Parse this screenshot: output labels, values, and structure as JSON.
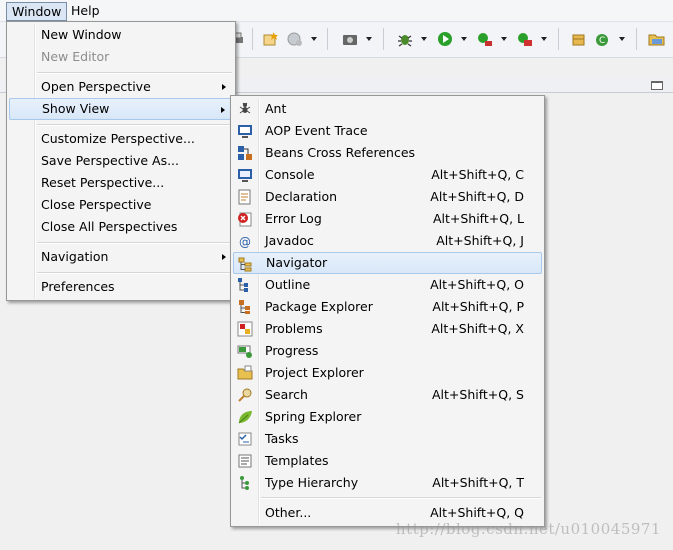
{
  "menubar": {
    "window": "Window",
    "help": "Help"
  },
  "window_menu": {
    "items": [
      {
        "label": "New Window",
        "disabled": false
      },
      {
        "label": "New Editor",
        "disabled": true
      },
      {
        "label": "Open Perspective",
        "submenu": true
      },
      {
        "label": "Show View",
        "submenu": true,
        "highlighted": true
      },
      {
        "label": "Customize Perspective..."
      },
      {
        "label": "Save Perspective As..."
      },
      {
        "label": "Reset Perspective..."
      },
      {
        "label": "Close Perspective"
      },
      {
        "label": "Close All Perspectives"
      },
      {
        "label": "Navigation",
        "submenu": true
      },
      {
        "label": "Preferences"
      }
    ]
  },
  "show_view_menu": {
    "items": [
      {
        "label": "Ant",
        "shortcut": "",
        "icon": "ant-icon"
      },
      {
        "label": "AOP Event Trace",
        "shortcut": "",
        "icon": "aop-event-trace-icon"
      },
      {
        "label": "Beans Cross References",
        "shortcut": "",
        "icon": "beans-cross-references-icon"
      },
      {
        "label": "Console",
        "shortcut": "Alt+Shift+Q, C",
        "icon": "console-icon"
      },
      {
        "label": "Declaration",
        "shortcut": "Alt+Shift+Q, D",
        "icon": "declaration-icon"
      },
      {
        "label": "Error Log",
        "shortcut": "Alt+Shift+Q, L",
        "icon": "error-log-icon"
      },
      {
        "label": "Javadoc",
        "shortcut": "Alt+Shift+Q, J",
        "icon": "javadoc-icon"
      },
      {
        "label": "Navigator",
        "shortcut": "",
        "icon": "navigator-icon",
        "highlighted": true
      },
      {
        "label": "Outline",
        "shortcut": "Alt+Shift+Q, O",
        "icon": "outline-icon"
      },
      {
        "label": "Package Explorer",
        "shortcut": "Alt+Shift+Q, P",
        "icon": "package-explorer-icon"
      },
      {
        "label": "Problems",
        "shortcut": "Alt+Shift+Q, X",
        "icon": "problems-icon"
      },
      {
        "label": "Progress",
        "shortcut": "",
        "icon": "progress-icon"
      },
      {
        "label": "Project Explorer",
        "shortcut": "",
        "icon": "project-explorer-icon"
      },
      {
        "label": "Search",
        "shortcut": "Alt+Shift+Q, S",
        "icon": "search-icon"
      },
      {
        "label": "Spring Explorer",
        "shortcut": "",
        "icon": "spring-explorer-icon"
      },
      {
        "label": "Tasks",
        "shortcut": "",
        "icon": "tasks-icon"
      },
      {
        "label": "Templates",
        "shortcut": "",
        "icon": "templates-icon"
      },
      {
        "label": "Type Hierarchy",
        "shortcut": "Alt+Shift+Q, T",
        "icon": "type-hierarchy-icon"
      },
      {
        "label": "Other...",
        "shortcut": "Alt+Shift+Q, Q",
        "icon": ""
      }
    ]
  },
  "watermark": "http://blog.csdn.net/u010045971",
  "colors": {
    "highlight_border": "#a8c8ec",
    "highlight_fill": "#dbe8f8",
    "menu_bg": "#f4f4f4"
  }
}
